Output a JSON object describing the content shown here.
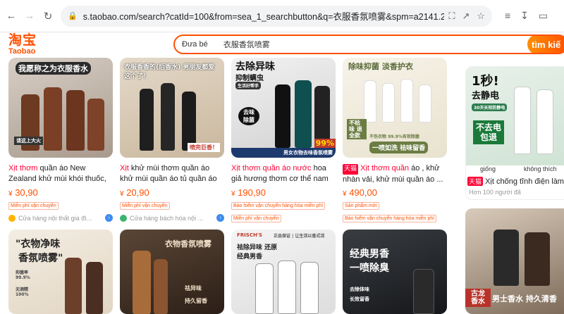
{
  "browser": {
    "url": "s.taobao.com/search?catId=100&from=sea_1_searchbutton&q=衣服香氛喷雾&spm=a2141.241046-cn.searchbar.d_2_searchbox&tmhkh5..."
  },
  "header": {
    "logo_cn": "淘宝",
    "logo_en": "Taobao",
    "search_scope": "Đưa bé",
    "search_query": "衣服香氛喷雾",
    "search_button": "tìm kiế"
  },
  "products": [
    {
      "img_text": "我愿称之为衣服香水",
      "img_badge": "请这上大火",
      "title_pre": "",
      "title_hl": "Xịt thơm",
      "title_post": " quần áo New Zealand khử mùi khói thuốc, diệt bọ v...",
      "price_cur": "¥",
      "price": "30,90",
      "tags": [
        "Miễn phí vận chuyển"
      ],
      "shop": "Cửa hàng nội thất gia đì..."
    },
    {
      "img_text": "衣服香香的(后香水) 男朋友都爱这个了！",
      "img_badge": "喷完巨香！",
      "title_pre": "",
      "title_hl": "Xịt",
      "title_post": " khử mùi thơm quần áo khử mùi quần áo tủ quần áo để khử...",
      "price_cur": "¥",
      "price": "20,90",
      "tags": [
        "Miễn phí vận chuyển"
      ],
      "shop": "Cửa hàng bách hóa nội ..."
    },
    {
      "img_text": "去除异味",
      "img_text2": "抑制螨虫",
      "img_badge": "生活好帮手",
      "img_badge2": "去味 除菌",
      "img_badge3": "男女衣物去味香氛喷雾",
      "img_badge4": "99%",
      "title_pre": "",
      "title_hl": "Xịt thơm quần áo nước",
      "title_post": " hoa giả hương thơm cơ thể nam hươ...",
      "price_cur": "¥",
      "price": "190,90",
      "tags": [
        "Bảo hiểm vận chuyển hàng hóa miễn phí",
        "Miễn phí vận chuyển"
      ],
      "shop": ""
    },
    {
      "img_text": "除味抑菌 淡香护衣",
      "img_badge": "不伤衣物 99.9%有效除菌",
      "img_badge2": "一喷如洗 祛味留香",
      "img_badge3": "不枯味 退全款",
      "tmall": "天猫",
      "title_pre": " ",
      "title_hl": "Xịt thơm quần",
      "title_post": " áo , khử nhàn vải, khử mùi quần áo ...",
      "price_cur": "¥",
      "price": "490,00",
      "tags": [
        "Sản phẩm mới",
        "Bảo hiểm vận chuyển hàng hóa miễn phí"
      ],
      "shop": ""
    },
    {
      "img_text": "1秒!",
      "img_text2": "去静电",
      "img_badge": "30天长效防静电",
      "img_badge2": "不去电 包退",
      "img_badge3": "giống",
      "img_badge4": "không thích",
      "tmall": "天猫",
      "title_hl": "",
      "title_post": " Xịt chống tĩnh điện làm...",
      "sold": "Hơn 100 người đã"
    },
    {
      "img_text": "\"衣物净味",
      "img_text2": "香氛喷雾\"",
      "img_badge": "抑菌率 99.9%",
      "img_badge2": "无酒精 100%"
    },
    {
      "img_text": "衣物香氛喷雾",
      "img_badge": "祛异味",
      "img_badge2": "持久留香"
    },
    {
      "img_text": "祛除异味 还原经典男香",
      "img_badge": "FRISCH'S",
      "img_badge2": "正品保证 | 让生活以香式活"
    },
    {
      "img_text": "经典男香",
      "img_text2": "一喷除臭",
      "img_badge": "去除体味",
      "img_badge2": "长效留香"
    },
    {
      "img_text": "古龙 香水",
      "img_badge": "男士香水 持久清香"
    }
  ],
  "colors": {
    "accent": "#ff5000",
    "highlight": "#ff0036",
    "tmall": "#ff0036"
  }
}
